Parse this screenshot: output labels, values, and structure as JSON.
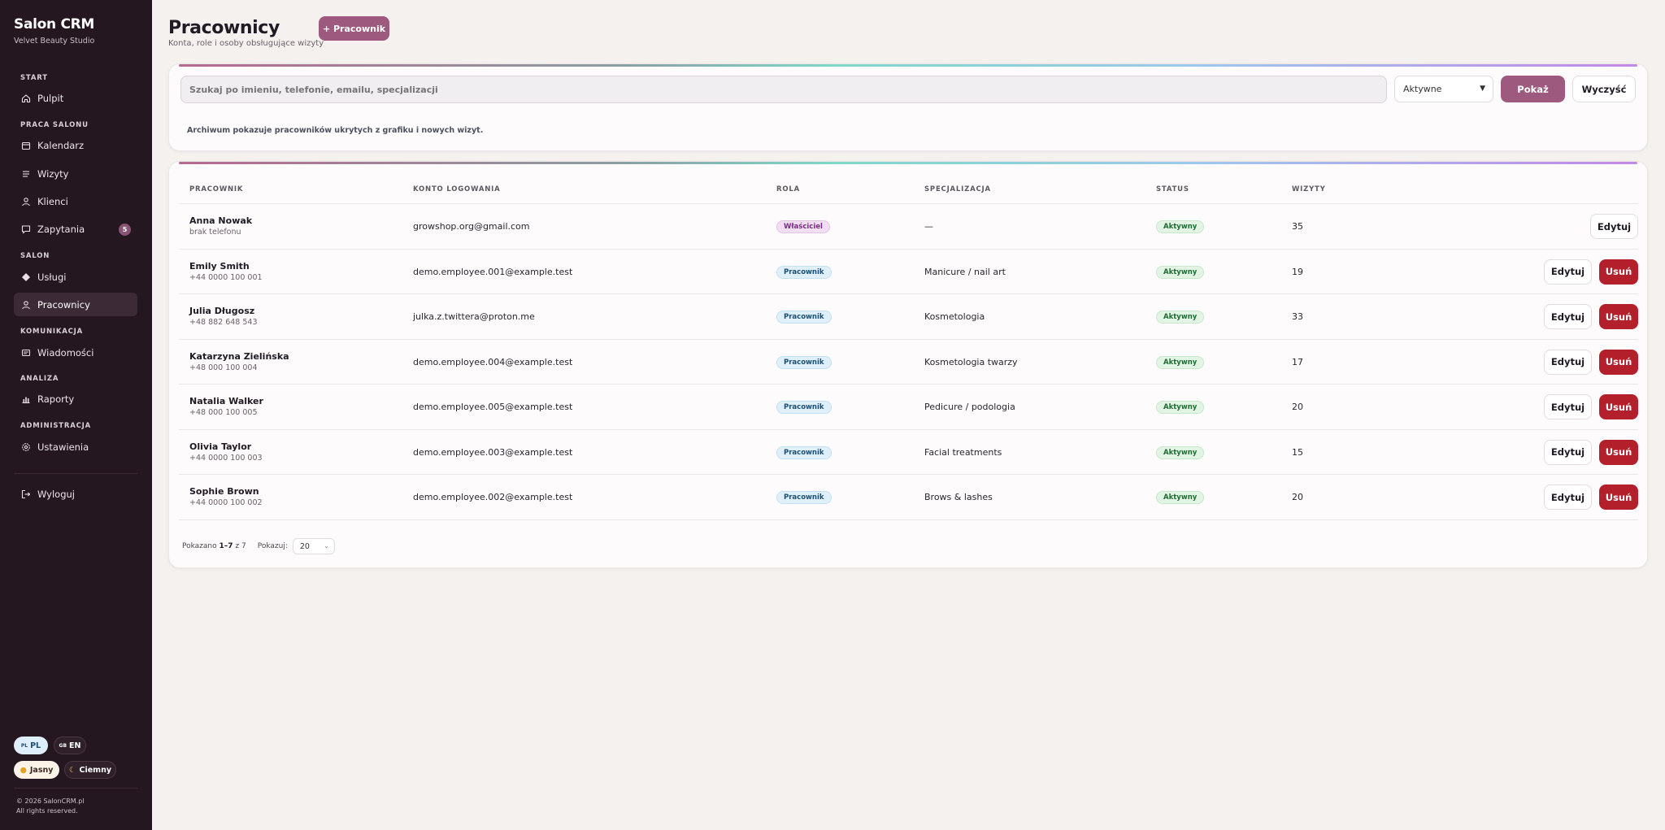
{
  "sidebar": {
    "brand": "Salon CRM",
    "studio": "Velvet Beauty Studio",
    "sections": {
      "start": "START",
      "work": "PRACA SALONU",
      "salon": "SALON",
      "communication": "KOMUNIKACJA",
      "analysis": "ANALIZA",
      "admin": "ADMINISTRACJA"
    },
    "items": {
      "dashboard": "Pulpit",
      "calendar": "Kalendarz",
      "visits": "Wizyty",
      "clients": "Klienci",
      "inquiries": "Zapytania",
      "inquiries_badge": "5",
      "services": "Usługi",
      "employees": "Pracownicy",
      "messages": "Wiadomości",
      "reports": "Raporty",
      "settings": "Ustawienia",
      "logout": "Wyloguj"
    },
    "lang": {
      "pl": "PL",
      "pl_prefix": "PL",
      "en": "EN",
      "en_prefix": "GB"
    },
    "theme": {
      "light": "Jasny",
      "dark": "Ciemny"
    },
    "footer": {
      "copyright": "© 2026 SalonCRM.pl",
      "rights": "All rights reserved."
    }
  },
  "header": {
    "title": "Pracownicy",
    "subtitle": "Konta, role i osoby obsługujące wizyty",
    "add_button": "+ Pracownik"
  },
  "filters": {
    "search_placeholder": "Szukaj po imieniu, telefonie, emailu, specjalizacji",
    "status_selected": "Aktywne",
    "show_button": "Pokaż",
    "clear_button": "Wyczyść",
    "archive_note": "Archiwum pokazuje pracowników ukrytych z grafiku i nowych wizyt."
  },
  "table": {
    "columns": {
      "employee": "PRACOWNIK",
      "account": "KONTO LOGOWANIA",
      "role": "ROLA",
      "specialization": "SPECJALIZACJA",
      "status": "STATUS",
      "visits": "WIZYTY"
    },
    "edit_label": "Edytuj",
    "delete_label": "Usuń",
    "rows": [
      {
        "name": "Anna Nowak",
        "phone": "brak telefonu",
        "email": "growshop.org@gmail.com",
        "role": "Właściciel",
        "spec": "—",
        "status": "Aktywny",
        "visits": "35"
      },
      {
        "name": "Emily Smith",
        "phone": "+44 0000 100 001",
        "email": "demo.employee.001@example.test",
        "role": "Pracownik",
        "spec": "Manicure / nail art",
        "status": "Aktywny",
        "visits": "19"
      },
      {
        "name": "Julia Długosz",
        "phone": "+48 882 648 543",
        "email": "julka.z.twittera@proton.me",
        "role": "Pracownik",
        "spec": "Kosmetologia",
        "status": "Aktywny",
        "visits": "33"
      },
      {
        "name": "Katarzyna Zielińska",
        "phone": "+48 000 100 004",
        "email": "demo.employee.004@example.test",
        "role": "Pracownik",
        "spec": "Kosmetologia twarzy",
        "status": "Aktywny",
        "visits": "17"
      },
      {
        "name": "Natalia Walker",
        "phone": "+48 000 100 005",
        "email": "demo.employee.005@example.test",
        "role": "Pracownik",
        "spec": "Pedicure / podologia",
        "status": "Aktywny",
        "visits": "20"
      },
      {
        "name": "Olivia Taylor",
        "phone": "+44 0000 100 003",
        "email": "demo.employee.003@example.test",
        "role": "Pracownik",
        "spec": "Facial treatments",
        "status": "Aktywny",
        "visits": "15"
      },
      {
        "name": "Sophie Brown",
        "phone": "+44 0000 100 002",
        "email": "demo.employee.002@example.test",
        "role": "Pracownik",
        "spec": "Brows & lashes",
        "status": "Aktywny",
        "visits": "20"
      }
    ]
  },
  "pagination": {
    "shown_label": "Pokazano",
    "range": "1–7",
    "of": "z 7",
    "page_size_label": "Pokazuj:",
    "page_size": "20"
  },
  "colors": {
    "accent": "#9e5a7e",
    "danger": "#b3202b",
    "sidebar": "#24171f"
  }
}
